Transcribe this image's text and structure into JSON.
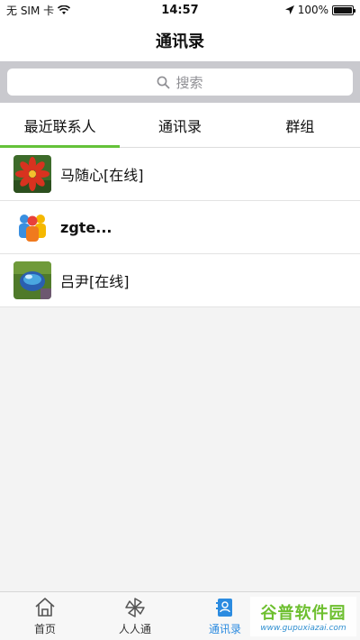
{
  "status_bar": {
    "carrier": "无 SIM 卡",
    "time": "14:57",
    "battery": "100%"
  },
  "nav": {
    "title": "通讯录"
  },
  "search": {
    "placeholder": "搜索"
  },
  "tabs": [
    {
      "label": "最近联系人",
      "active": true
    },
    {
      "label": "通讯录",
      "active": false
    },
    {
      "label": "群组",
      "active": false
    }
  ],
  "contacts": [
    {
      "name": "马随心[在线]",
      "avatar": "red-flower-photo"
    },
    {
      "name": "zgte...",
      "avatar": "colorful-people-logo"
    },
    {
      "name": "吕尹[在线]",
      "avatar": "water-droplet-photo"
    }
  ],
  "bottom_tabs": [
    {
      "label": "首页",
      "icon": "home-icon",
      "active": false
    },
    {
      "label": "人人通",
      "icon": "pinwheel-icon",
      "active": false
    },
    {
      "label": "通讯录",
      "icon": "contacts-book-icon",
      "active": true
    }
  ],
  "watermark": {
    "title": "谷普软件园",
    "url": "www.gupuxiazai.com"
  },
  "colors": {
    "accent_green": "#64c23a",
    "active_blue": "#2b8be0"
  }
}
